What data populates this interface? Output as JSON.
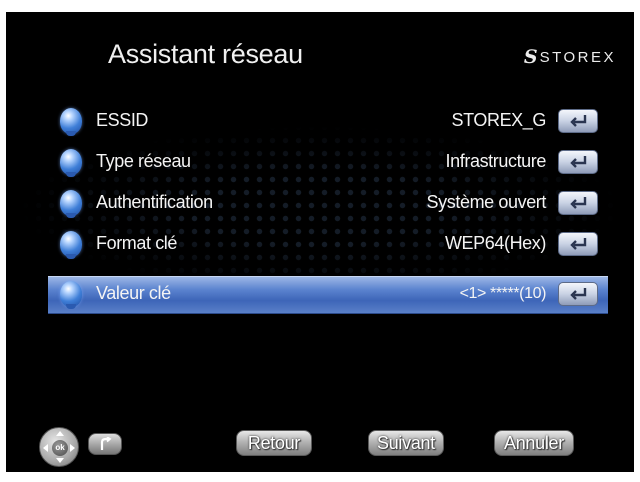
{
  "header": {
    "title": "Assistant réseau",
    "brand_mark": "S",
    "brand_text": "STOREX"
  },
  "settings": [
    {
      "label": "ESSID",
      "value": "STOREX_G",
      "selected": false
    },
    {
      "label": "Type réseau",
      "value": "Infrastructure",
      "selected": false
    },
    {
      "label": "Authentification",
      "value": "Système ouvert",
      "selected": false
    },
    {
      "label": "Format clé",
      "value": "WEP64(Hex)",
      "selected": false
    },
    {
      "label": "Valeur clé",
      "value": "<1> *****(10)",
      "selected": true
    }
  ],
  "footer": {
    "ok_label": "ok",
    "back_label": "Retour",
    "next_label": "Suivant",
    "cancel_label": "Annuler"
  },
  "colors": {
    "background": "#000000",
    "selection": "#4a74c4",
    "text": "#f4f4f4"
  },
  "icons": [
    "bulb-icon",
    "enter-key-icon",
    "dpad-ok-icon",
    "return-arrow-icon"
  ]
}
